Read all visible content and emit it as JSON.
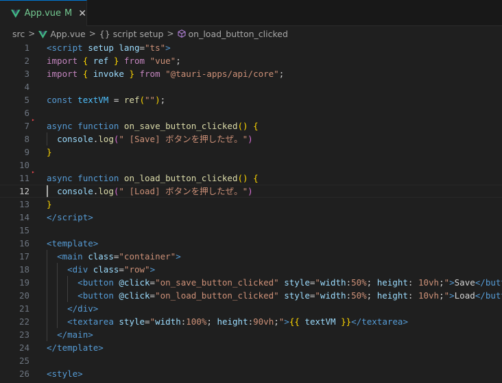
{
  "tab": {
    "filename": "App.vue",
    "modified": "M",
    "close_glyph": "✕"
  },
  "breadcrumb": {
    "items": [
      "src",
      "App.vue",
      "{} script setup",
      "on_load_button_clicked"
    ],
    "separator": ">"
  },
  "editor": {
    "active_line": 12,
    "lines": [
      {
        "n": "1",
        "tokens": [
          [
            "tag",
            "<"
          ],
          [
            "tag",
            "script"
          ],
          [
            "txt",
            " "
          ],
          [
            "attr",
            "setup"
          ],
          [
            "txt",
            " "
          ],
          [
            "attr",
            "lang"
          ],
          [
            "txt",
            "="
          ],
          [
            "str",
            "\"ts\""
          ],
          [
            "tag",
            ">"
          ]
        ]
      },
      {
        "n": "2",
        "tokens": [
          [
            "kw",
            "import"
          ],
          [
            "txt",
            " "
          ],
          [
            "brk",
            "{"
          ],
          [
            "txt",
            " "
          ],
          [
            "var",
            "ref"
          ],
          [
            "txt",
            " "
          ],
          [
            "brk",
            "}"
          ],
          [
            "txt",
            " "
          ],
          [
            "kw",
            "from"
          ],
          [
            "txt",
            " "
          ],
          [
            "str",
            "\"vue\""
          ],
          [
            "txt",
            ";"
          ]
        ]
      },
      {
        "n": "3",
        "tokens": [
          [
            "kw",
            "import"
          ],
          [
            "txt",
            " "
          ],
          [
            "brk",
            "{"
          ],
          [
            "txt",
            " "
          ],
          [
            "var",
            "invoke"
          ],
          [
            "txt",
            " "
          ],
          [
            "brk",
            "}"
          ],
          [
            "txt",
            " "
          ],
          [
            "kw",
            "from"
          ],
          [
            "txt",
            " "
          ],
          [
            "str",
            "\"@tauri-apps/api/core\""
          ],
          [
            "txt",
            ";"
          ]
        ]
      },
      {
        "n": "4",
        "tokens": []
      },
      {
        "n": "5",
        "tokens": [
          [
            "bkw",
            "const"
          ],
          [
            "txt",
            " "
          ],
          [
            "const",
            "textVM"
          ],
          [
            "txt",
            " = "
          ],
          [
            "fn",
            "ref"
          ],
          [
            "brk",
            "("
          ],
          [
            "str",
            "\"\""
          ],
          [
            "brk",
            ")"
          ],
          [
            "txt",
            ";"
          ]
        ]
      },
      {
        "n": "6",
        "tokens": []
      },
      {
        "n": "7",
        "tokens": [
          [
            "bkw",
            "async"
          ],
          [
            "txt",
            " "
          ],
          [
            "bkw",
            "function"
          ],
          [
            "txt",
            " "
          ],
          [
            "fn",
            "on_save_button_clicked"
          ],
          [
            "brk",
            "()"
          ],
          [
            "txt",
            " "
          ],
          [
            "brk",
            "{"
          ]
        ]
      },
      {
        "n": "8",
        "tokens": [
          [
            "txt",
            "  "
          ],
          [
            "var",
            "console"
          ],
          [
            "txt",
            "."
          ],
          [
            "fn",
            "log"
          ],
          [
            "brk2",
            "("
          ],
          [
            "str",
            "\" [Save] ボタンを押したぜ。\""
          ],
          [
            "brk2",
            ")"
          ]
        ]
      },
      {
        "n": "9",
        "tokens": [
          [
            "brk",
            "}"
          ]
        ]
      },
      {
        "n": "10",
        "tokens": []
      },
      {
        "n": "11",
        "tokens": [
          [
            "bkw",
            "async"
          ],
          [
            "txt",
            " "
          ],
          [
            "bkw",
            "function"
          ],
          [
            "txt",
            " "
          ],
          [
            "fn",
            "on_load_button_clicked"
          ],
          [
            "brk",
            "()"
          ],
          [
            "txt",
            " "
          ],
          [
            "brk",
            "{"
          ]
        ]
      },
      {
        "n": "12",
        "tokens": [
          [
            "txt",
            "  "
          ],
          [
            "var",
            "console"
          ],
          [
            "txt",
            "."
          ],
          [
            "fn",
            "log"
          ],
          [
            "brk2",
            "("
          ],
          [
            "str",
            "\" [Load] ボタンを押したぜ。\""
          ],
          [
            "brk2",
            ")"
          ]
        ]
      },
      {
        "n": "13",
        "tokens": [
          [
            "brk",
            "}"
          ]
        ]
      },
      {
        "n": "14",
        "tokens": [
          [
            "tag",
            "</"
          ],
          [
            "tag",
            "script"
          ],
          [
            "tag",
            ">"
          ]
        ]
      },
      {
        "n": "15",
        "tokens": []
      },
      {
        "n": "16",
        "tokens": [
          [
            "tag",
            "<"
          ],
          [
            "tag",
            "template"
          ],
          [
            "tag",
            ">"
          ]
        ]
      },
      {
        "n": "17",
        "tokens": [
          [
            "txt",
            "  "
          ],
          [
            "tag",
            "<"
          ],
          [
            "tag",
            "main"
          ],
          [
            "txt",
            " "
          ],
          [
            "attr",
            "class"
          ],
          [
            "txt",
            "="
          ],
          [
            "str",
            "\"container\""
          ],
          [
            "tag",
            ">"
          ]
        ]
      },
      {
        "n": "18",
        "tokens": [
          [
            "txt",
            "    "
          ],
          [
            "tag",
            "<"
          ],
          [
            "tag",
            "div"
          ],
          [
            "txt",
            " "
          ],
          [
            "attr",
            "class"
          ],
          [
            "txt",
            "="
          ],
          [
            "str",
            "\"row\""
          ],
          [
            "tag",
            ">"
          ]
        ]
      },
      {
        "n": "19",
        "tokens": [
          [
            "txt",
            "      "
          ],
          [
            "tag",
            "<"
          ],
          [
            "tag",
            "button"
          ],
          [
            "txt",
            " "
          ],
          [
            "attr",
            "@click"
          ],
          [
            "txt",
            "="
          ],
          [
            "str",
            "\"on_save_button_clicked\""
          ],
          [
            "txt",
            " "
          ],
          [
            "attr",
            "style"
          ],
          [
            "txt",
            "="
          ],
          [
            "str",
            "\""
          ],
          [
            "attr",
            "width"
          ],
          [
            "txt",
            ":"
          ],
          [
            "str",
            "50%"
          ],
          [
            "txt",
            "; "
          ],
          [
            "attr",
            "height"
          ],
          [
            "txt",
            ": "
          ],
          [
            "str",
            "10vh"
          ],
          [
            "txt",
            ";"
          ],
          [
            "str",
            "\""
          ],
          [
            "tag",
            ">"
          ],
          [
            "txt",
            "Save"
          ],
          [
            "tag",
            "</"
          ],
          [
            "tag",
            "button"
          ],
          [
            "tag",
            ">"
          ]
        ]
      },
      {
        "n": "20",
        "tokens": [
          [
            "txt",
            "      "
          ],
          [
            "tag",
            "<"
          ],
          [
            "tag",
            "button"
          ],
          [
            "txt",
            " "
          ],
          [
            "attr",
            "@click"
          ],
          [
            "txt",
            "="
          ],
          [
            "str",
            "\"on_load_button_clicked\""
          ],
          [
            "txt",
            " "
          ],
          [
            "attr",
            "style"
          ],
          [
            "txt",
            "="
          ],
          [
            "str",
            "\""
          ],
          [
            "attr",
            "width"
          ],
          [
            "txt",
            ":"
          ],
          [
            "str",
            "50%"
          ],
          [
            "txt",
            "; "
          ],
          [
            "attr",
            "height"
          ],
          [
            "txt",
            ": "
          ],
          [
            "str",
            "10vh"
          ],
          [
            "txt",
            ";"
          ],
          [
            "str",
            "\""
          ],
          [
            "tag",
            ">"
          ],
          [
            "txt",
            "Load"
          ],
          [
            "tag",
            "</"
          ],
          [
            "tag",
            "button"
          ],
          [
            "tag",
            ">"
          ]
        ]
      },
      {
        "n": "21",
        "tokens": [
          [
            "txt",
            "    "
          ],
          [
            "tag",
            "</"
          ],
          [
            "tag",
            "div"
          ],
          [
            "tag",
            ">"
          ]
        ]
      },
      {
        "n": "22",
        "tokens": [
          [
            "txt",
            "    "
          ],
          [
            "tag",
            "<"
          ],
          [
            "tag",
            "textarea"
          ],
          [
            "txt",
            " "
          ],
          [
            "attr",
            "style"
          ],
          [
            "txt",
            "="
          ],
          [
            "str",
            "\""
          ],
          [
            "attr",
            "width"
          ],
          [
            "txt",
            ":"
          ],
          [
            "str",
            "100%"
          ],
          [
            "txt",
            "; "
          ],
          [
            "attr",
            "height"
          ],
          [
            "txt",
            ":"
          ],
          [
            "str",
            "90vh"
          ],
          [
            "txt",
            ";"
          ],
          [
            "str",
            "\""
          ],
          [
            "tag",
            ">"
          ],
          [
            "brk",
            "{{"
          ],
          [
            "txt",
            " "
          ],
          [
            "var",
            "textVM"
          ],
          [
            "txt",
            " "
          ],
          [
            "brk",
            "}}"
          ],
          [
            "tag",
            "</"
          ],
          [
            "tag",
            "textarea"
          ],
          [
            "tag",
            ">"
          ]
        ]
      },
      {
        "n": "23",
        "tokens": [
          [
            "txt",
            "  "
          ],
          [
            "tag",
            "</"
          ],
          [
            "tag",
            "main"
          ],
          [
            "tag",
            ">"
          ]
        ]
      },
      {
        "n": "24",
        "tokens": [
          [
            "tag",
            "</"
          ],
          [
            "tag",
            "template"
          ],
          [
            "tag",
            ">"
          ]
        ]
      },
      {
        "n": "25",
        "tokens": []
      },
      {
        "n": "26",
        "tokens": [
          [
            "tag",
            "<"
          ],
          [
            "tag",
            "style"
          ],
          [
            "tag",
            ">"
          ]
        ]
      }
    ]
  },
  "colors": {
    "background": "#1f1f1f",
    "tab_active_border": "#0078d4",
    "modified": "#73c991",
    "breakpoint_arrow": "#e5484d"
  },
  "icons": [
    "vue-icon",
    "close-icon",
    "chevron-right-icon",
    "braces-icon",
    "cube-icon",
    "fold-arrow-icon"
  ]
}
